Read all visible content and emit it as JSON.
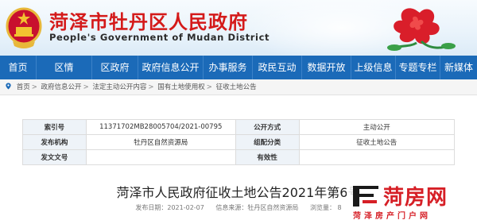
{
  "header": {
    "title": "菏泽市牡丹区人民政府",
    "subtitle": "People's Government of Mudan District"
  },
  "nav": {
    "items": [
      "首页",
      "区情",
      "区政府",
      "政府信息公开",
      "办事服务",
      "政民互动",
      "数据开放",
      "上级信息",
      "专题专栏",
      "新媒体"
    ]
  },
  "breadcrumb": {
    "items": [
      "首页",
      "政府信息公开",
      "法定主动公开内容",
      "国有土地使用权",
      "征收土地公告"
    ]
  },
  "info_table": {
    "rows": [
      {
        "label1": "索引号",
        "value1": "11371702MB28005704/2021-00795",
        "label2": "公开方式",
        "value2": "主动公开"
      },
      {
        "label1": "发布机构",
        "value1": "牡丹区自然资源局",
        "label2": "组配分类",
        "value2": "征收土地公告"
      },
      {
        "label1": "发文文号",
        "value1": "",
        "label2": "有效性",
        "value2": ""
      }
    ]
  },
  "article": {
    "title": "菏泽市人民政府征收土地公告2021年第6号",
    "publish_date": "发布日期：2021-02-07",
    "source": "信息来源：牡丹区自然资源局",
    "views": "浏览量：  8"
  },
  "watermark": {
    "brand": "菏房网",
    "brand_sub": "菏泽房产门户网"
  },
  "colors": {
    "brand_red": "#d41a1a",
    "nav_blue": "#1b6ab8"
  }
}
